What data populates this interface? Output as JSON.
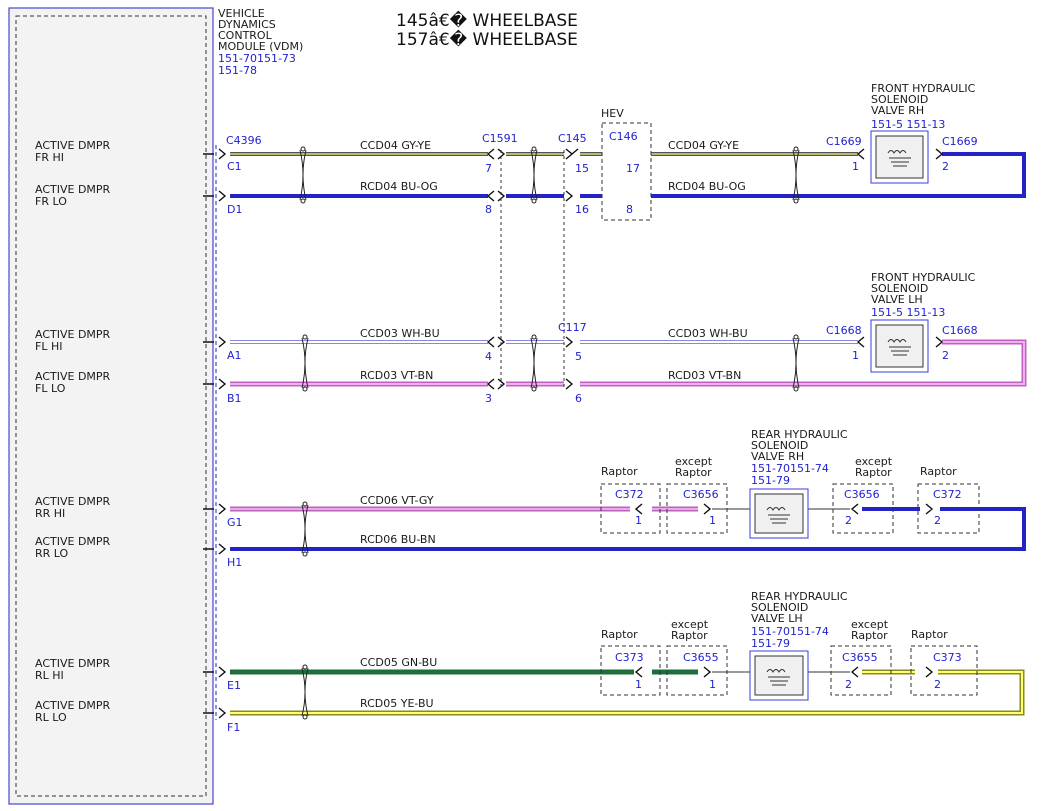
{
  "title": {
    "line1": "145â€� WHEELBASE",
    "line2": "157â€� WHEELBASE"
  },
  "module": {
    "name_lines": [
      "VEHICLE",
      "DYNAMICS",
      "CONTROL",
      "MODULE (VDM)"
    ],
    "refs": [
      "151-70151-73",
      "151-78"
    ],
    "connector": "C4396"
  },
  "ports": [
    {
      "label": [
        "ACTIVE DMPR",
        "FR HI"
      ],
      "pin": "C1"
    },
    {
      "label": [
        "ACTIVE DMPR",
        "FR LO"
      ],
      "pin": "D1"
    },
    {
      "label": [
        "ACTIVE DMPR",
        "FL HI"
      ],
      "pin": "A1"
    },
    {
      "label": [
        "ACTIVE DMPR",
        "FL LO"
      ],
      "pin": "B1"
    },
    {
      "label": [
        "ACTIVE DMPR",
        "RR HI"
      ],
      "pin": "G1"
    },
    {
      "label": [
        "ACTIVE DMPR",
        "RR LO"
      ],
      "pin": "H1"
    },
    {
      "label": [
        "ACTIVE DMPR",
        "RL HI"
      ],
      "pin": "E1"
    },
    {
      "label": [
        "ACTIVE DMPR",
        "RL LO"
      ],
      "pin": "F1"
    }
  ],
  "circuits": {
    "fr_hi": {
      "left": "CCD04  GY-YE",
      "right": "CCD04  GY-YE"
    },
    "fr_lo": {
      "left": "RCD04  BU-OG",
      "right": "RCD04  BU-OG"
    },
    "fl_hi": {
      "left": "CCD03  WH-BU",
      "right": "CCD03  WH-BU"
    },
    "fl_lo": {
      "left": "RCD03  VT-BN",
      "right": "RCD03  VT-BN"
    },
    "rr_hi": "CCD06  VT-GY",
    "rr_lo": "RCD06  BU-BN",
    "rl_hi": "CCD05  GN-BU",
    "rl_lo": "RCD05  YE-BU"
  },
  "inline_connectors": {
    "c1591": {
      "name": "C1591",
      "pins": [
        "7",
        "8",
        "4",
        "3"
      ]
    },
    "c145": {
      "name": "C145",
      "pins": [
        "15",
        "16"
      ]
    },
    "c117": {
      "name": "C117",
      "pins": [
        "5",
        "6"
      ]
    },
    "hev": {
      "label": "HEV",
      "name": "C146",
      "pins": [
        "17",
        "8"
      ]
    }
  },
  "solenoids": {
    "front_rh": {
      "lines": [
        "FRONT HYDRAULIC",
        "SOLENOID",
        "VALVE RH"
      ],
      "refs": "151-5  151-13",
      "conn_in": "C1669",
      "conn_out": "C1669",
      "pin_in": "1",
      "pin_out": "2"
    },
    "front_lh": {
      "lines": [
        "FRONT HYDRAULIC",
        "SOLENOID",
        "VALVE LH"
      ],
      "refs": "151-5  151-13",
      "conn_in": "C1668",
      "conn_out": "C1668",
      "pin_in": "1",
      "pin_out": "2"
    },
    "rear_rh": {
      "lines": [
        "REAR HYDRAULIC",
        "SOLENOID",
        "VALVE RH"
      ],
      "refs": [
        "151-70151-74",
        "151-79"
      ]
    },
    "rear_lh": {
      "lines": [
        "REAR HYDRAULIC",
        "SOLENOID",
        "VALVE LH"
      ],
      "refs": [
        "151-70151-74",
        "151-79"
      ]
    }
  },
  "rear_rh_connectors": [
    {
      "variant": "Raptor",
      "name": "C372",
      "pin": "1"
    },
    {
      "variant": "except Raptor",
      "name": "C3656",
      "pin": "1"
    },
    {
      "variant": "except Raptor",
      "name": "C3656",
      "pin": "2"
    },
    {
      "variant": "Raptor",
      "name": "C372",
      "pin": "2"
    }
  ],
  "rear_lh_connectors": [
    {
      "variant": "Raptor",
      "name": "C373",
      "pin": "1"
    },
    {
      "variant": "except Raptor",
      "name": "C3655",
      "pin": "1"
    },
    {
      "variant": "except Raptor",
      "name": "C3655",
      "pin": "2"
    },
    {
      "variant": "Raptor",
      "name": "C373",
      "pin": "2"
    }
  ],
  "colors": {
    "connector_text": "#1f1fd0",
    "wire_gy_ye": "#8c8c52",
    "wire_bu": "#2323c8",
    "wire_wh_bu": "#c8c8ff",
    "wire_vt": "#d27fd2",
    "wire_gn": "#1e6e3c",
    "wire_ye": "#e6e632"
  }
}
